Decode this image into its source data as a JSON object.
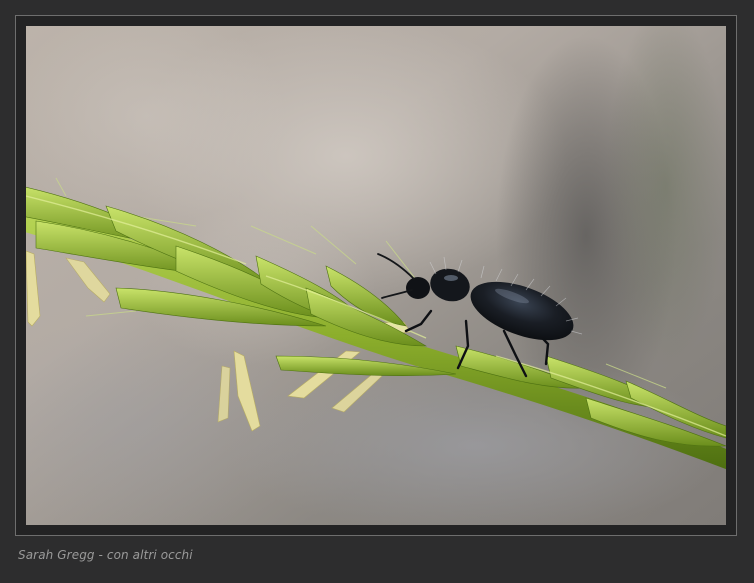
{
  "photo": {
    "subject": "beetle-on-grass",
    "colors": {
      "background_light": "#c4bcb4",
      "background_dark": "#6c6a68",
      "stem": "#8cae2c",
      "stem_dark": "#4d6e10",
      "beetle": "#161a20"
    }
  },
  "caption": {
    "text": "Sarah Gregg - con altri occhi"
  }
}
